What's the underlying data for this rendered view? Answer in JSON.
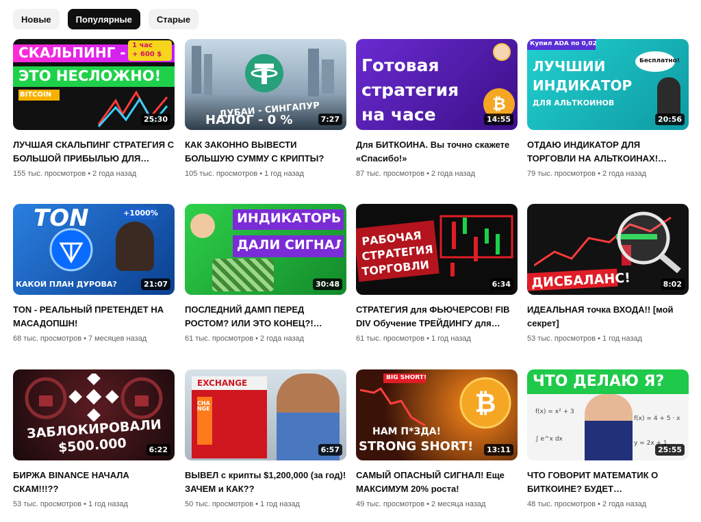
{
  "filters": [
    {
      "label": "Новые",
      "active": false
    },
    {
      "label": "Популярные",
      "active": true
    },
    {
      "label": "Старые",
      "active": false
    }
  ],
  "videos": [
    {
      "title": "ЛУЧШАЯ СКАЛЬПИНГ СТРАТЕГИЯ С БОЛЬШОЙ ПРИБЫЛЬЮ ДЛЯ…",
      "views": "155 тыс. просмотров",
      "age": "2 года назад",
      "duration": "25:30",
      "thumb_text": [
        "СКАЛЬПИНГ -",
        "ЭТО НЕСЛОЖНО!",
        "BITCOIN"
      ],
      "badge": [
        "1 час",
        "+ 600 $"
      ],
      "bg": "#111111"
    },
    {
      "title": "КАК ЗАКОННО ВЫВЕСТИ БОЛЬШУЮ СУММУ С КРИПТЫ?",
      "views": "105 тыс. просмотров",
      "age": "1 год назад",
      "duration": "7:27",
      "thumb_text": [
        "ДУБАЙ - СИНГАПУР",
        "НАЛОГ - 0 %"
      ],
      "bg": "#8fa6b8"
    },
    {
      "title": "Для БИТКОИНА. Вы точно скажете «Спасибо!»",
      "views": "87 тыс. просмотров",
      "age": "2 года назад",
      "duration": "14:55",
      "thumb_text": [
        "Готовая",
        "стратегия",
        "на часе"
      ],
      "bg": "#5a1fa8"
    },
    {
      "title": "ОТДАЮ ИНДИКАТОР ДЛЯ ТОРГОВЛИ НА АЛЬТКОИНАХ!…",
      "views": "79 тыс. просмотров",
      "age": "2 года назад",
      "duration": "20:56",
      "thumb_text": [
        "ЛУЧШИЙ",
        "ИНДИКАТОР",
        "ДЛЯ АЛЬТКОИНОВ"
      ],
      "badge": [
        "Купил ADA по 0,02"
      ],
      "bubble": "Бесплатно!",
      "bg": "#14b5b5"
    },
    {
      "title": "TON - РЕАЛЬНЫЙ ПРЕТЕНДЕТ НА МАСАДОПШН!",
      "views": "68 тыс. просмотров",
      "age": "7 месяцев назад",
      "duration": "21:07",
      "thumb_text": [
        "TON",
        "КАКОЙ ПЛАН ДУРОВА?"
      ],
      "badge": [
        "+1000%"
      ],
      "bg": "#1363c7"
    },
    {
      "title": "ПОСЛЕДНИЙ ДАМП ПЕРЕД РОСТОМ? ИЛИ ЭТО КОНЕЦ?!…",
      "views": "61 тыс. просмотров",
      "age": "2 года назад",
      "duration": "30:48",
      "thumb_text": [
        "ИНДИКАТОРЫ",
        "ДАЛИ СИГНАЛ !"
      ],
      "bg": "#21a33b"
    },
    {
      "title": "СТРАТЕГИЯ для ФЬЮЧЕРСОВ! FIB DIV Обучение ТРЕЙДИНГУ для…",
      "views": "61 тыс. просмотров",
      "age": "1 год назад",
      "duration": "6:34",
      "thumb_text": [
        "РАБОЧАЯ",
        "СТРАТЕГИЯ",
        "ТОРГОВЛИ"
      ],
      "bg": "#0c0c0c"
    },
    {
      "title": "ИДЕАЛЬНАЯ точка ВХОДА!! [мой секрет]",
      "views": "53 тыс. просмотров",
      "age": "1 год назад",
      "duration": "8:02",
      "thumb_text": [
        "ДИСБАЛАНС!"
      ],
      "bg": "#121212"
    },
    {
      "title": "БИРЖА BINANCE НАЧАЛА СКАМ!!!??",
      "views": "53 тыс. просмотров",
      "age": "1 год назад",
      "duration": "6:22",
      "thumb_text": [
        "ЗАБЛОКИРОВАЛИ",
        "$500.000"
      ],
      "bg": "#2a0f12"
    },
    {
      "title": "ВЫВЕЛ с крипты $1,200,000 (за год)! ЗАЧЕМ и КАК??",
      "views": "50 тыс. просмотров",
      "age": "1 год назад",
      "duration": "6:57",
      "thumb_text": [
        "EXCHANGE",
        "CHANGE"
      ],
      "bg": "#c9d6df"
    },
    {
      "title": "САМЫЙ ОПАСНЫЙ СИГНАЛ! Еще МАКСИМУМ 20% роста!",
      "views": "49 тыс. просмотров",
      "age": "2 месяца назад",
      "duration": "13:11",
      "thumb_text": [
        "BIG SHORT!",
        "НАМ П*ЗДА!",
        "STRONG SHORT!"
      ],
      "bg": "#1a0d08"
    },
    {
      "title": "ЧТО ГОВОРИТ МАТЕМАТИК О БИТКОИНЕ? БУДЕТ…",
      "views": "48 тыс. просмотров",
      "age": "2 года назад",
      "duration": "25:55",
      "thumb_text": [
        "ЧТО ДЕЛАЮ Я?"
      ],
      "bg": "#f2f2f2"
    }
  ],
  "colors": {
    "chip_bg": "#f2f2f2",
    "chip_active_bg": "#0f0f0f",
    "meta_text": "#606060",
    "title_text": "#0f0f0f"
  }
}
